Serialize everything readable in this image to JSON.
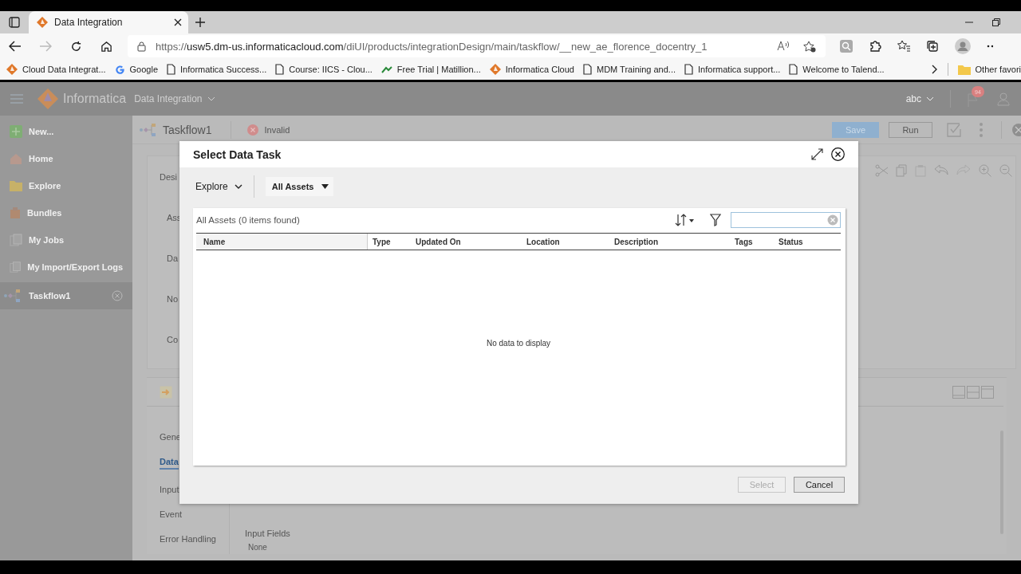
{
  "browser": {
    "tab_title": "Data Integration",
    "url_scheme": "https://",
    "url_host": "usw5.dm-us.informaticacloud.com",
    "url_path": "/diUI/products/integrationDesign/main/taskflow/__new_ae_florence_docentry_1",
    "bookmarks": [
      {
        "label": "Cloud Data Integrat...",
        "kind": "diamond"
      },
      {
        "label": "Google",
        "kind": "google"
      },
      {
        "label": "Informatica Success...",
        "kind": "page"
      },
      {
        "label": "Course: IICS - Clou...",
        "kind": "page"
      },
      {
        "label": "Free Trial | Matillion...",
        "kind": "chevron"
      },
      {
        "label": "Informatica Cloud",
        "kind": "diamond"
      },
      {
        "label": "MDM Training and...",
        "kind": "page"
      },
      {
        "label": "Informatica support...",
        "kind": "page"
      },
      {
        "label": "Welcome to Talend...",
        "kind": "page"
      }
    ],
    "other_favorites": "Other favori"
  },
  "app": {
    "brand": "Informatica",
    "product": "Data Integration",
    "user": "abc",
    "notification_count": "94"
  },
  "sidebar": {
    "items": [
      {
        "label": "New...",
        "kind": "new",
        "selected": false
      },
      {
        "label": "Home",
        "kind": "home",
        "selected": false
      },
      {
        "label": "Explore",
        "kind": "folder",
        "selected": false
      },
      {
        "label": "Bundles",
        "kind": "bundle",
        "selected": false
      },
      {
        "label": "My Jobs",
        "kind": "doc",
        "selected": false
      },
      {
        "label": "My Import/Export Logs",
        "kind": "doc",
        "selected": false
      },
      {
        "label": "Taskflow1",
        "kind": "taskflow",
        "selected": true
      }
    ]
  },
  "editor": {
    "title": "Taskflow1",
    "status": "Invalid",
    "save": "Save",
    "run": "Run",
    "design_labels": [
      "Desi",
      "Ass",
      "Da",
      "No",
      "Co"
    ],
    "property_tabs": [
      {
        "label": "Gene",
        "selected": false
      },
      {
        "label": "Data",
        "selected": true
      },
      {
        "label": "Input",
        "selected": false
      },
      {
        "label": "Event",
        "selected": false
      },
      {
        "label": "Error Handling",
        "selected": false
      }
    ],
    "input_fields_label": "Input Fields",
    "input_fields_value": "None"
  },
  "dialog": {
    "title": "Select Data Task",
    "explore": "Explore",
    "asset_filter": "All Assets",
    "count_text": "All Assets (0 items found)",
    "columns": [
      "Name",
      "Type",
      "Updated On",
      "Location",
      "Description",
      "Tags",
      "Status"
    ],
    "empty_message": "No data to display",
    "buttons": [
      {
        "label": "Select",
        "disabled": true
      },
      {
        "label": "Cancel",
        "disabled": false
      }
    ]
  }
}
